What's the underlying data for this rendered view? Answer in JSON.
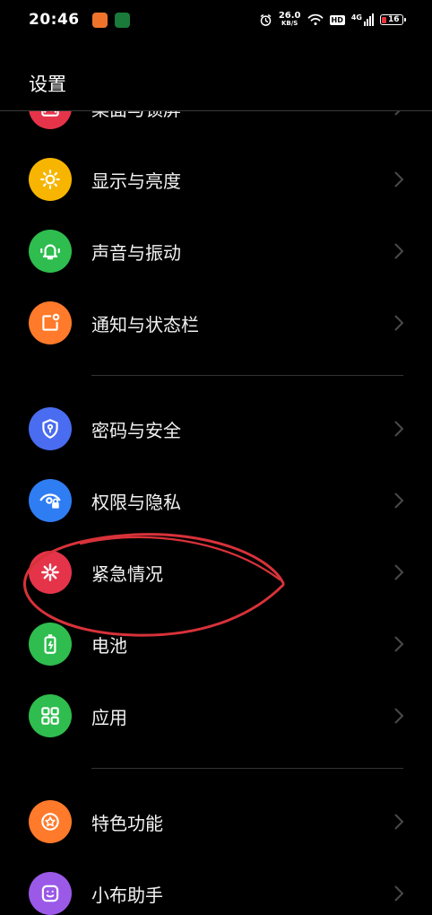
{
  "status_bar": {
    "time": "20:46",
    "net_speed_value": "26.0",
    "net_speed_unit": "KB/S",
    "hd": "HD",
    "network": "4G",
    "battery": "16",
    "colors": {
      "battery_low": "#e5343c"
    }
  },
  "header": {
    "title": "设置"
  },
  "settings": {
    "group1": [
      {
        "label": "桌面与锁屏",
        "icon": "wallpaper-icon",
        "color": "#e5344a"
      },
      {
        "label": "显示与亮度",
        "icon": "sun-icon",
        "color": "#f7b500"
      },
      {
        "label": "声音与振动",
        "icon": "bell-icon",
        "color": "#2ebd4e"
      },
      {
        "label": "通知与状态栏",
        "icon": "notification-icon",
        "color": "#ff7a2a"
      }
    ],
    "group2": [
      {
        "label": "密码与安全",
        "icon": "shield-key-icon",
        "color": "#4a6cf0"
      },
      {
        "label": "权限与隐私",
        "icon": "eye-lock-icon",
        "color": "#2f7df2"
      },
      {
        "label": "紧急情况",
        "icon": "asterisk-icon",
        "color": "#e5344a"
      },
      {
        "label": "电池",
        "icon": "battery-icon",
        "color": "#2ebd4e"
      },
      {
        "label": "应用",
        "icon": "apps-grid-icon",
        "color": "#2ebd4e"
      }
    ],
    "group3": [
      {
        "label": "特色功能",
        "icon": "star-icon",
        "color": "#ff7a2a"
      },
      {
        "label": "小布助手",
        "icon": "assistant-icon",
        "color": "#9b59e8"
      }
    ]
  },
  "annotation_color": "#d8323a"
}
